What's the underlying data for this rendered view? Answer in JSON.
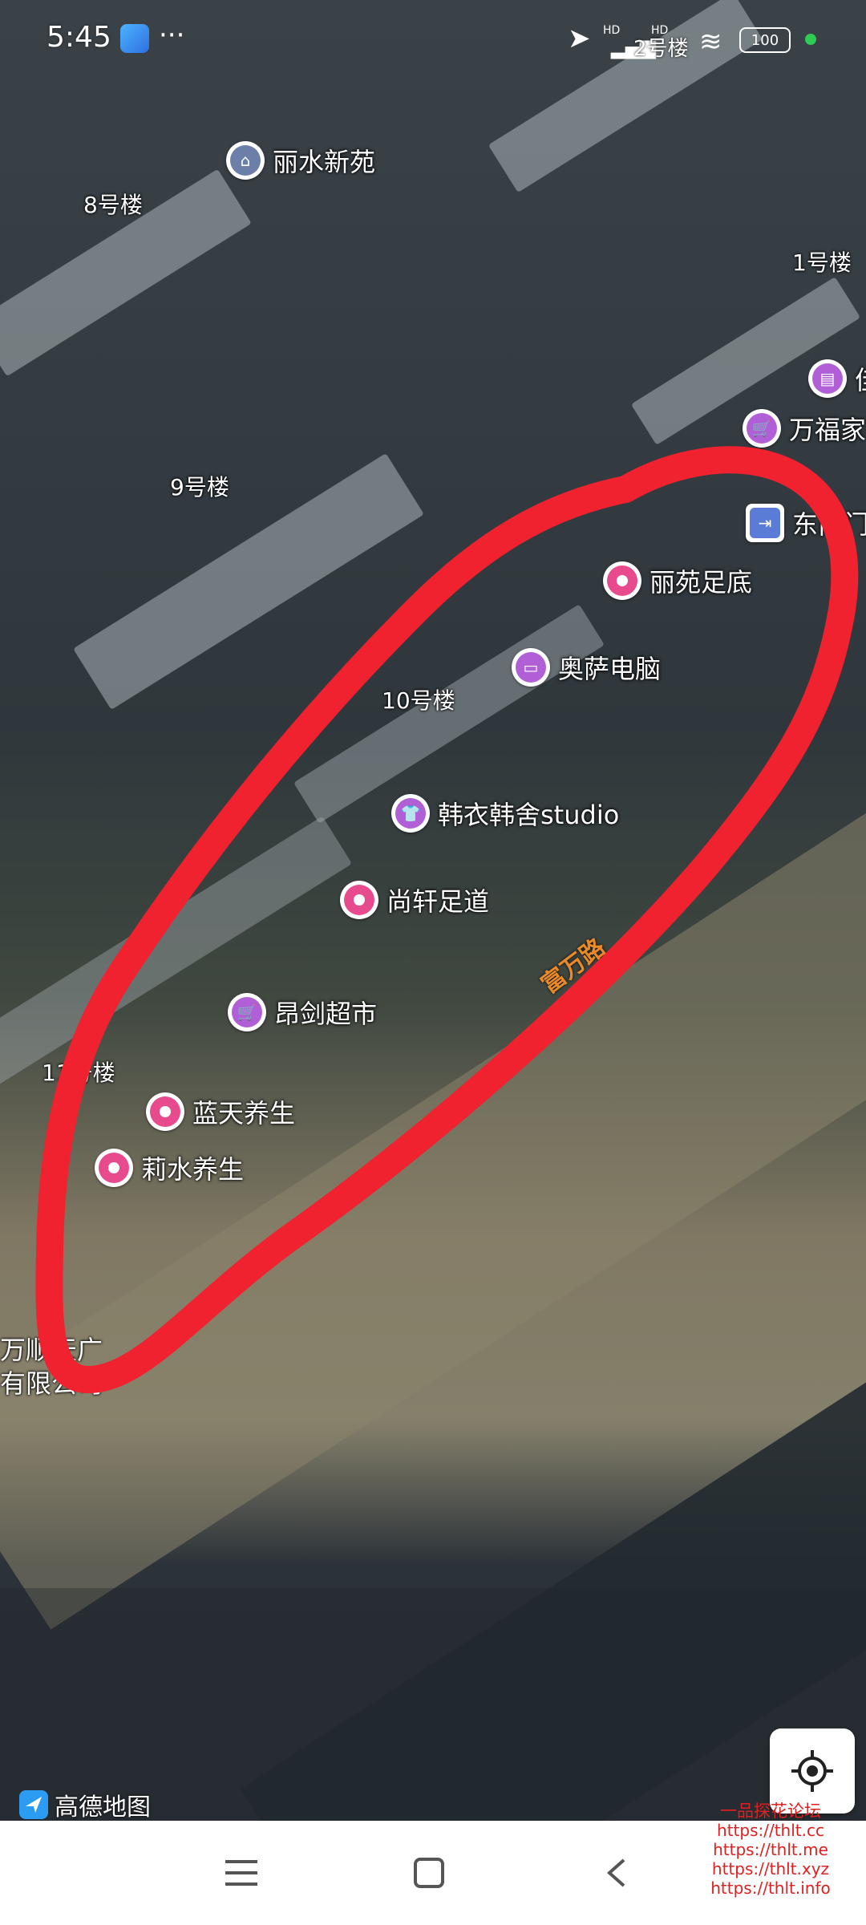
{
  "status_bar": {
    "time": "5:45",
    "more": "···",
    "signal_label_1": "HD",
    "signal_label_2": "HD",
    "battery": "100",
    "overlay_text": "2号楼"
  },
  "map": {
    "building_labels": {
      "b8": "8号楼",
      "b1": "1号楼",
      "b9": "9号楼",
      "b10": "10号楼",
      "b11": "11号楼"
    },
    "road_label": "富万路",
    "partial_texts": {
      "left_line1": "万顺天广",
      "left_line2": "有限公司",
      "right_1": "佳",
      "right_2": "万福家",
      "right_3": "东南门"
    },
    "pois": [
      {
        "name": "丽水新苑",
        "icon": "residential-icon",
        "color": "#6b7fa8"
      },
      {
        "name": "丽苑足底",
        "icon": "dot-icon",
        "color": "#e84a8e"
      },
      {
        "name": "奥萨电脑",
        "icon": "computer-icon",
        "color": "#b15fd6"
      },
      {
        "name": "韩衣韩舍studio",
        "icon": "shirt-icon",
        "color": "#b15fd6"
      },
      {
        "name": "尚轩足道",
        "icon": "dot-icon",
        "color": "#e84a8e"
      },
      {
        "name": "昂剑超市",
        "icon": "cart-icon",
        "color": "#b15fd6"
      },
      {
        "name": "蓝天养生",
        "icon": "dot-icon",
        "color": "#e84a8e"
      },
      {
        "name": "莉水养生",
        "icon": "dot-icon",
        "color": "#e84a8e"
      }
    ],
    "annotation_color": "#f0222f",
    "logo_text": "高德地图"
  },
  "watermark": {
    "title": "一品探花论坛",
    "urls": [
      "https://thlt.cc",
      "https://thlt.me",
      "https://thlt.xyz",
      "https://thlt.info"
    ]
  },
  "nav": {
    "menu_icon": "menu-icon",
    "home_icon": "home-icon",
    "back_icon": "back-icon"
  }
}
